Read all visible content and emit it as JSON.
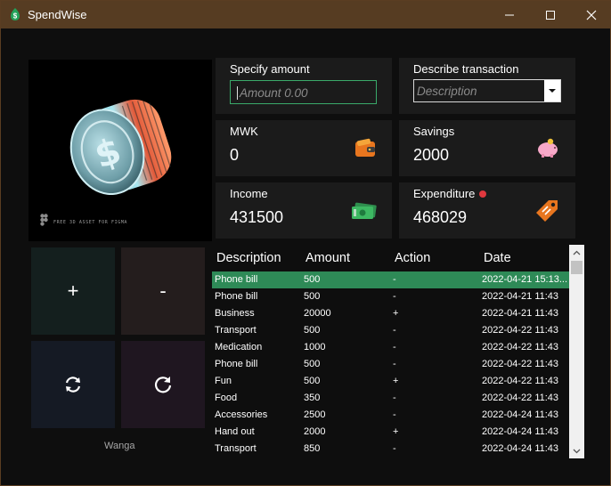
{
  "window": {
    "title": "SpendWise"
  },
  "hero": {
    "caption": "FREE 3D ASSET FOR FIGMA"
  },
  "inputs": {
    "amount": {
      "label": "Specify amount",
      "placeholder": "Amount 0.00"
    },
    "description": {
      "label": "Describe transaction",
      "placeholder": "Description"
    }
  },
  "cards": {
    "currency": {
      "label": "MWK",
      "value": "0",
      "icon": "wallet-icon"
    },
    "savings": {
      "label": "Savings",
      "value": "2000",
      "icon": "piggy-bank-icon"
    },
    "income": {
      "label": "Income",
      "value": "431500",
      "icon": "cash-icon"
    },
    "expenditure": {
      "label": "Expenditure",
      "value": "468029",
      "icon": "price-tag-icon"
    }
  },
  "actions": {
    "add": "+",
    "subtract": "-"
  },
  "footer": {
    "name": "Wanga"
  },
  "table": {
    "headers": [
      "Description",
      "Amount",
      "Action",
      "Date"
    ],
    "rows": [
      {
        "description": "Phone bill",
        "amount": "500",
        "action": "-",
        "date": "2022-04-21 15:13..."
      },
      {
        "description": "Phone bill",
        "amount": "500",
        "action": "-",
        "date": "2022-04-21 11:43"
      },
      {
        "description": "Business",
        "amount": "20000",
        "action": "+",
        "date": "2022-04-21 11:43"
      },
      {
        "description": "Transport",
        "amount": "500",
        "action": "-",
        "date": "2022-04-22 11:43"
      },
      {
        "description": "Medication",
        "amount": "1000",
        "action": "-",
        "date": "2022-04-22 11:43"
      },
      {
        "description": "Phone bill",
        "amount": "500",
        "action": "-",
        "date": "2022-04-22 11:43"
      },
      {
        "description": "Fun",
        "amount": "500",
        "action": "+",
        "date": "2022-04-22 11:43"
      },
      {
        "description": "Food",
        "amount": "350",
        "action": "-",
        "date": "2022-04-22 11:43"
      },
      {
        "description": "Accessories",
        "amount": "2500",
        "action": "-",
        "date": "2022-04-24 11:43"
      },
      {
        "description": "Hand out",
        "amount": "2000",
        "action": "+",
        "date": "2022-04-24 11:43"
      },
      {
        "description": "Transport",
        "amount": "850",
        "action": "-",
        "date": "2022-04-24 11:43"
      }
    ]
  },
  "colors": {
    "titlebar": "#563c22",
    "accent_green": "#2e8a57",
    "card_bg": "#1b1b1b",
    "alert_red": "#e0383e"
  }
}
